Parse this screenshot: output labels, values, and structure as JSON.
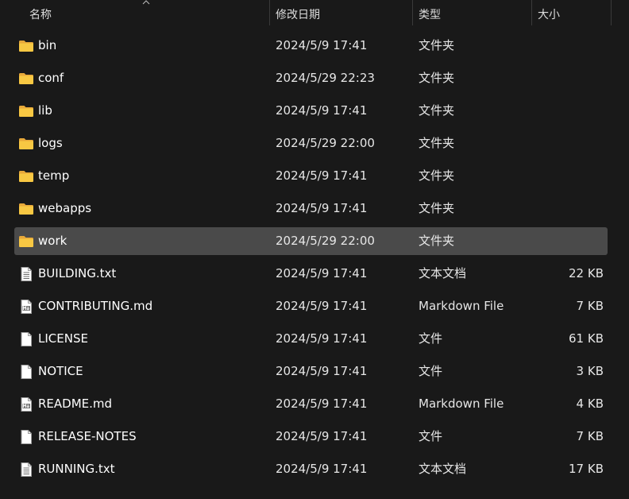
{
  "header": {
    "name_label": "名称",
    "date_label": "修改日期",
    "type_label": "类型",
    "size_label": "大小"
  },
  "colors": {
    "background": "#191919",
    "selected_row": "#4a4a4a",
    "folder_yellow": "#f8c843",
    "text": "#ffffff"
  },
  "files": [
    {
      "name": "bin",
      "date": "2024/5/9 17:41",
      "type": "文件夹",
      "size": "",
      "icon": "folder-icon",
      "selected": false
    },
    {
      "name": "conf",
      "date": "2024/5/29 22:23",
      "type": "文件夹",
      "size": "",
      "icon": "folder-icon",
      "selected": false
    },
    {
      "name": "lib",
      "date": "2024/5/9 17:41",
      "type": "文件夹",
      "size": "",
      "icon": "folder-icon",
      "selected": false
    },
    {
      "name": "logs",
      "date": "2024/5/29 22:00",
      "type": "文件夹",
      "size": "",
      "icon": "folder-icon",
      "selected": false
    },
    {
      "name": "temp",
      "date": "2024/5/9 17:41",
      "type": "文件夹",
      "size": "",
      "icon": "folder-icon",
      "selected": false
    },
    {
      "name": "webapps",
      "date": "2024/5/9 17:41",
      "type": "文件夹",
      "size": "",
      "icon": "folder-icon",
      "selected": false
    },
    {
      "name": "work",
      "date": "2024/5/29 22:00",
      "type": "文件夹",
      "size": "",
      "icon": "folder-icon",
      "selected": true
    },
    {
      "name": "BUILDING.txt",
      "date": "2024/5/9 17:41",
      "type": "文本文档",
      "size": "22 KB",
      "icon": "text-file-icon",
      "selected": false
    },
    {
      "name": "CONTRIBUTING.md",
      "date": "2024/5/9 17:41",
      "type": "Markdown File",
      "size": "7 KB",
      "icon": "markdown-file-icon",
      "selected": false
    },
    {
      "name": "LICENSE",
      "date": "2024/5/9 17:41",
      "type": "文件",
      "size": "61 KB",
      "icon": "blank-file-icon",
      "selected": false
    },
    {
      "name": "NOTICE",
      "date": "2024/5/9 17:41",
      "type": "文件",
      "size": "3 KB",
      "icon": "blank-file-icon",
      "selected": false
    },
    {
      "name": "README.md",
      "date": "2024/5/9 17:41",
      "type": "Markdown File",
      "size": "4 KB",
      "icon": "markdown-file-icon",
      "selected": false
    },
    {
      "name": "RELEASE-NOTES",
      "date": "2024/5/9 17:41",
      "type": "文件",
      "size": "7 KB",
      "icon": "blank-file-icon",
      "selected": false
    },
    {
      "name": "RUNNING.txt",
      "date": "2024/5/9 17:41",
      "type": "文本文档",
      "size": "17 KB",
      "icon": "text-file-icon",
      "selected": false
    }
  ]
}
